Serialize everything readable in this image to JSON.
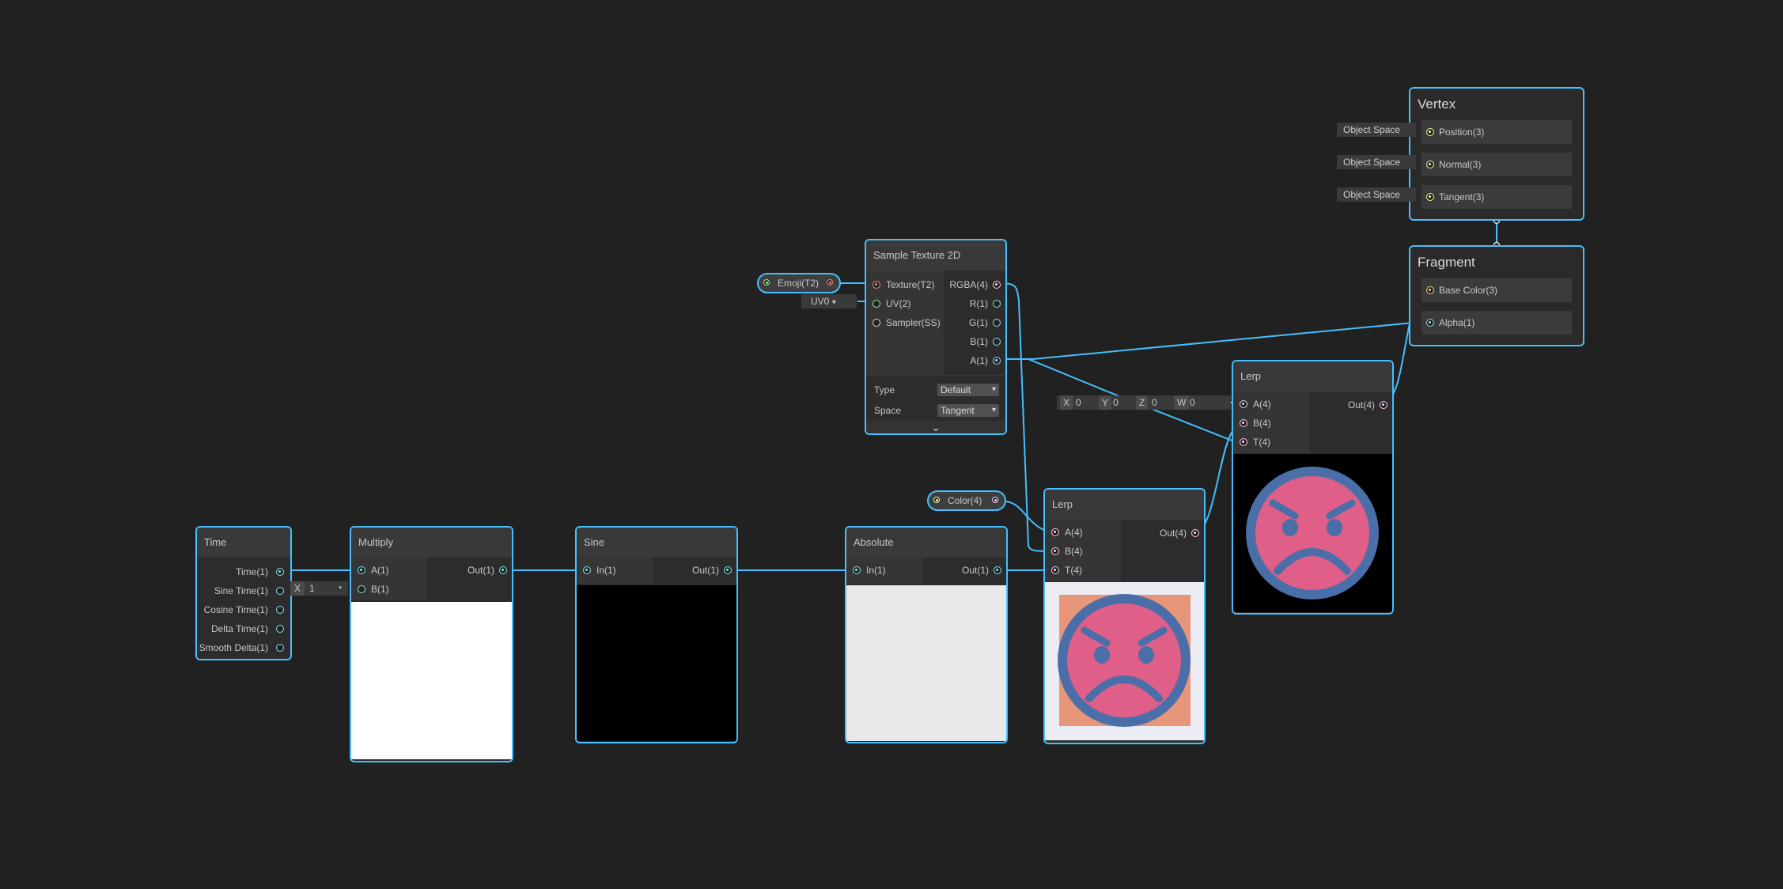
{
  "colors": {
    "background": "#212121",
    "wire": "#44c0ff",
    "node_border": "#44c0ff",
    "node_bg": "#2c2c2c",
    "preview_face": "#e05f88",
    "preview_ring": "#4a6ea8",
    "preview_face_bg": "#e8967a"
  },
  "vertex": {
    "title": "Vertex",
    "ports": [
      {
        "label": "Position(3)",
        "space": "Object Space"
      },
      {
        "label": "Normal(3)",
        "space": "Object Space"
      },
      {
        "label": "Tangent(3)",
        "space": "Object Space"
      }
    ]
  },
  "fragment": {
    "title": "Fragment",
    "ports": [
      {
        "label": "Base Color(3)"
      },
      {
        "label": "Alpha(1)"
      }
    ]
  },
  "sample_texture": {
    "title": "Sample Texture 2D",
    "inputs": [
      "Texture(T2)",
      "UV(2)",
      "Sampler(SS)"
    ],
    "outputs": [
      "RGBA(4)",
      "R(1)",
      "G(1)",
      "B(1)",
      "A(1)"
    ],
    "type_label": "Type",
    "type_value": "Default",
    "space_label": "Space",
    "space_value": "Tangent",
    "expand_icon": "chevron-down-icon"
  },
  "emoji_property": {
    "label": "Emoji(T2)"
  },
  "uv_field": {
    "value": "UV0"
  },
  "color_property": {
    "label": "Color(4)"
  },
  "lerp_top": {
    "title": "Lerp",
    "inputs": [
      "A(4)",
      "B(4)",
      "T(4)"
    ],
    "output": "Out(4)",
    "vector_field": {
      "x_label": "X",
      "x": "0",
      "y_label": "Y",
      "y": "0",
      "z_label": "Z",
      "z": "0",
      "w_label": "W",
      "w": "0"
    }
  },
  "lerp_bottom": {
    "title": "Lerp",
    "inputs": [
      "A(4)",
      "B(4)",
      "T(4)"
    ],
    "output": "Out(4)"
  },
  "time": {
    "title": "Time",
    "outputs": [
      "Time(1)",
      "Sine Time(1)",
      "Cosine Time(1)",
      "Delta Time(1)",
      "Smooth Delta(1)"
    ]
  },
  "multiply": {
    "title": "Multiply",
    "inputs": [
      "A(1)",
      "B(1)"
    ],
    "output": "Out(1)",
    "b_field": {
      "label": "X",
      "value": "1"
    }
  },
  "sine": {
    "title": "Sine",
    "input": "In(1)",
    "output": "Out(1)"
  },
  "absolute": {
    "title": "Absolute",
    "input": "In(1)",
    "output": "Out(1)"
  }
}
